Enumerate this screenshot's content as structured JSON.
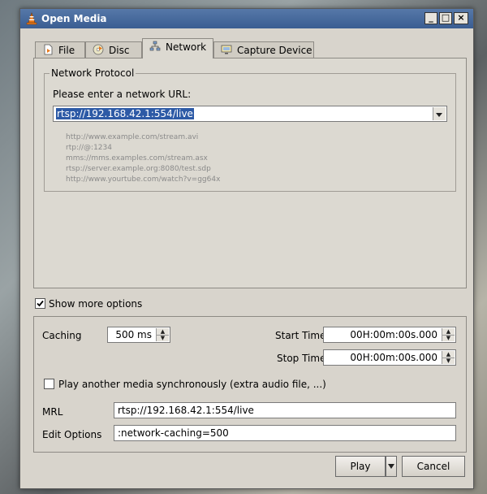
{
  "window": {
    "title": "Open Media",
    "minimize_symbol": "_",
    "maximize_symbol": "□",
    "close_symbol": "×"
  },
  "tabs": [
    {
      "label": "File",
      "icon": "file-icon"
    },
    {
      "label": "Disc",
      "icon": "disc-icon"
    },
    {
      "label": "Network",
      "icon": "network-icon",
      "active": true
    },
    {
      "label": "Capture Device",
      "icon": "capture-device-icon"
    }
  ],
  "network": {
    "group_title": "Network Protocol",
    "url_prompt": "Please enter a network URL:",
    "url_value": "rtsp://192.168.42.1:554/live",
    "examples": [
      "http://www.example.com/stream.avi",
      "rtp://@:1234",
      "mms://mms.examples.com/stream.asx",
      "rtsp://server.example.org:8080/test.sdp",
      "http://www.yourtube.com/watch?v=gg64x"
    ]
  },
  "more_options": {
    "show_label": "Show more options",
    "show_checked": true,
    "caching_label": "Caching",
    "caching_value": "500 ms",
    "start_time_label": "Start Time",
    "start_time_value": "00H:00m:00s.000",
    "stop_time_label": "Stop Time",
    "stop_time_value": "00H:00m:00s.000",
    "sync_label": "Play another media synchronously (extra audio file, ...)",
    "sync_checked": false,
    "mrl_label": "MRL",
    "mrl_value": "rtsp://192.168.42.1:554/live",
    "edit_options_label": "Edit Options",
    "edit_options_value": ":network-caching=500"
  },
  "buttons": {
    "play": "Play",
    "cancel": "Cancel"
  },
  "colors": {
    "titlebar": "#3a5d92",
    "selection": "#2d5aa6",
    "vlc_orange": "#e8791c"
  }
}
